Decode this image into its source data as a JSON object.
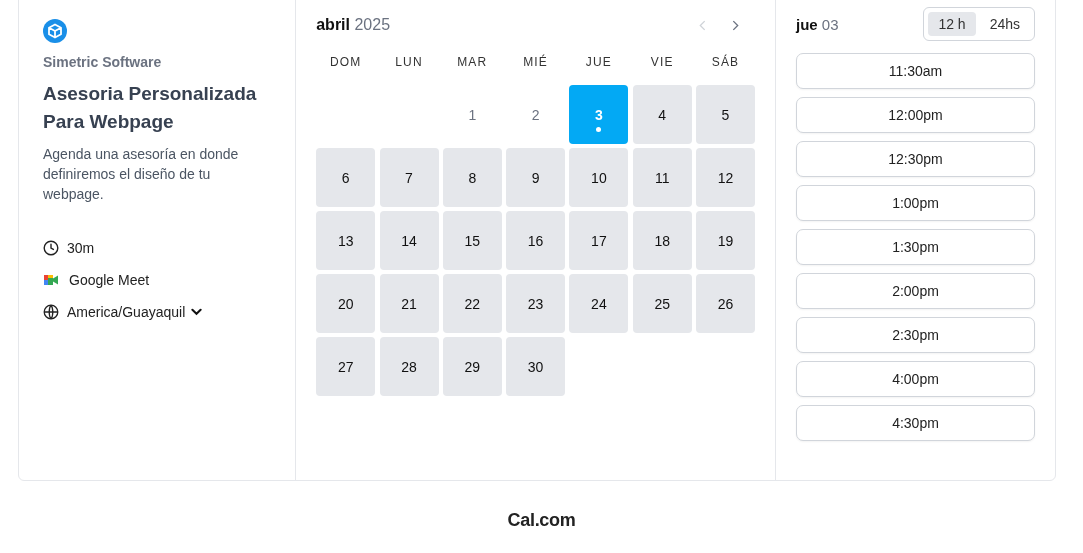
{
  "organizer": {
    "name": "Simetric Software"
  },
  "event": {
    "title": "Asesoria Personalizada Para Webpage",
    "description": "Agenda una asesoría en donde definiremos el diseño de tu webpage.",
    "duration": "30m",
    "location": "Google Meet",
    "timezone": "America/Guayaquil"
  },
  "calendar": {
    "month": "abril",
    "year": "2025",
    "prev_disabled": true,
    "next_disabled": false,
    "weekdays": [
      "DOM",
      "LUN",
      "MAR",
      "MIÉ",
      "JUE",
      "VIE",
      "SÁB"
    ],
    "days": [
      {
        "kind": "blank"
      },
      {
        "kind": "blank"
      },
      {
        "kind": "day",
        "label": "1",
        "available": false,
        "selected": false,
        "today": false
      },
      {
        "kind": "day",
        "label": "2",
        "available": false,
        "selected": false,
        "today": false
      },
      {
        "kind": "day",
        "label": "3",
        "available": true,
        "selected": true,
        "today": true
      },
      {
        "kind": "day",
        "label": "4",
        "available": true,
        "selected": false,
        "today": false
      },
      {
        "kind": "day",
        "label": "5",
        "available": true,
        "selected": false,
        "today": false
      },
      {
        "kind": "day",
        "label": "6",
        "available": true,
        "selected": false,
        "today": false
      },
      {
        "kind": "day",
        "label": "7",
        "available": true,
        "selected": false,
        "today": false
      },
      {
        "kind": "day",
        "label": "8",
        "available": true,
        "selected": false,
        "today": false
      },
      {
        "kind": "day",
        "label": "9",
        "available": true,
        "selected": false,
        "today": false
      },
      {
        "kind": "day",
        "label": "10",
        "available": true,
        "selected": false,
        "today": false
      },
      {
        "kind": "day",
        "label": "11",
        "available": true,
        "selected": false,
        "today": false
      },
      {
        "kind": "day",
        "label": "12",
        "available": true,
        "selected": false,
        "today": false
      },
      {
        "kind": "day",
        "label": "13",
        "available": true,
        "selected": false,
        "today": false
      },
      {
        "kind": "day",
        "label": "14",
        "available": true,
        "selected": false,
        "today": false
      },
      {
        "kind": "day",
        "label": "15",
        "available": true,
        "selected": false,
        "today": false
      },
      {
        "kind": "day",
        "label": "16",
        "available": true,
        "selected": false,
        "today": false
      },
      {
        "kind": "day",
        "label": "17",
        "available": true,
        "selected": false,
        "today": false
      },
      {
        "kind": "day",
        "label": "18",
        "available": true,
        "selected": false,
        "today": false
      },
      {
        "kind": "day",
        "label": "19",
        "available": true,
        "selected": false,
        "today": false
      },
      {
        "kind": "day",
        "label": "20",
        "available": true,
        "selected": false,
        "today": false
      },
      {
        "kind": "day",
        "label": "21",
        "available": true,
        "selected": false,
        "today": false
      },
      {
        "kind": "day",
        "label": "22",
        "available": true,
        "selected": false,
        "today": false
      },
      {
        "kind": "day",
        "label": "23",
        "available": true,
        "selected": false,
        "today": false
      },
      {
        "kind": "day",
        "label": "24",
        "available": true,
        "selected": false,
        "today": false
      },
      {
        "kind": "day",
        "label": "25",
        "available": true,
        "selected": false,
        "today": false
      },
      {
        "kind": "day",
        "label": "26",
        "available": true,
        "selected": false,
        "today": false
      },
      {
        "kind": "day",
        "label": "27",
        "available": true,
        "selected": false,
        "today": false
      },
      {
        "kind": "day",
        "label": "28",
        "available": true,
        "selected": false,
        "today": false
      },
      {
        "kind": "day",
        "label": "29",
        "available": true,
        "selected": false,
        "today": false
      },
      {
        "kind": "day",
        "label": "30",
        "available": true,
        "selected": false,
        "today": false
      }
    ]
  },
  "slots": {
    "weekday": "jue",
    "date": "03",
    "formats": [
      {
        "label": "12 h",
        "selected": true
      },
      {
        "label": "24hs",
        "selected": false
      }
    ],
    "times": [
      "11:30am",
      "12:00pm",
      "12:30pm",
      "1:00pm",
      "1:30pm",
      "2:00pm",
      "2:30pm",
      "4:00pm",
      "4:30pm"
    ]
  },
  "footer": {
    "brand": "Cal.com"
  }
}
